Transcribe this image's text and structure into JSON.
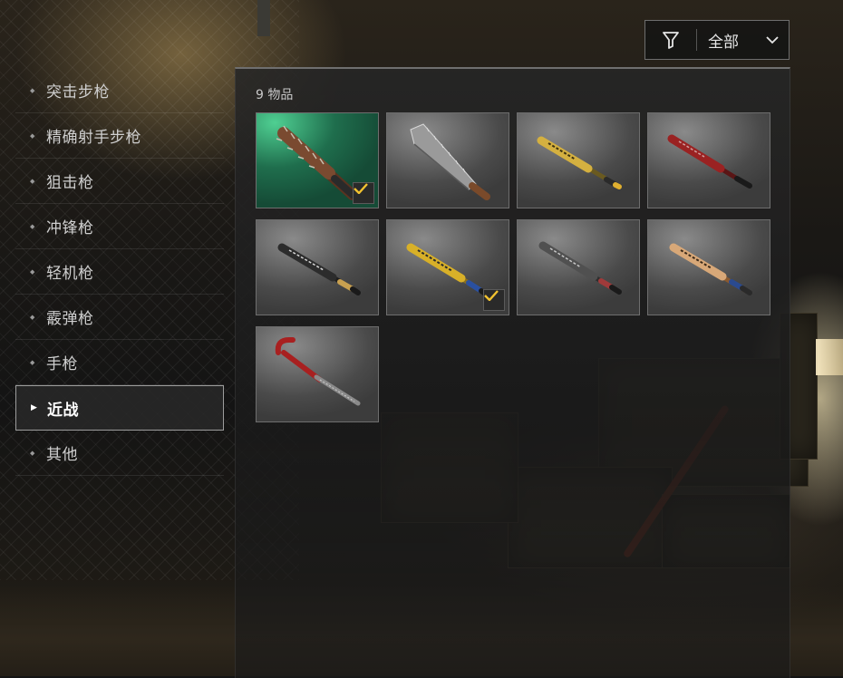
{
  "filter": {
    "value": "全部",
    "icon": "filter-icon",
    "chevron_icon": "chevron-down-icon"
  },
  "categories": [
    {
      "label": "突击步枪",
      "active": false
    },
    {
      "label": "精确射手步枪",
      "active": false
    },
    {
      "label": "狙击枪",
      "active": false
    },
    {
      "label": "冲锋枪",
      "active": false
    },
    {
      "label": "轻机枪",
      "active": false
    },
    {
      "label": "霰弹枪",
      "active": false
    },
    {
      "label": "手枪",
      "active": false
    },
    {
      "label": "近战",
      "active": true
    },
    {
      "label": "其他",
      "active": false
    }
  ],
  "items_count": "9 物品",
  "items": [
    {
      "name": "spiked-bat-item",
      "equipped": true,
      "rarity": "green"
    },
    {
      "name": "machete-item",
      "equipped": false,
      "rarity": "gray"
    },
    {
      "name": "gold-bat-item",
      "equipped": false,
      "rarity": "gray"
    },
    {
      "name": "red-bat-item",
      "equipped": false,
      "rarity": "gray"
    },
    {
      "name": "black-bat-item",
      "equipped": false,
      "rarity": "gray"
    },
    {
      "name": "yellow-blue-bat-item",
      "equipped": true,
      "rarity": "gray"
    },
    {
      "name": "gray-bat-item",
      "equipped": false,
      "rarity": "gray"
    },
    {
      "name": "wooden-bat-item",
      "equipped": false,
      "rarity": "gray"
    },
    {
      "name": "crowbar-item",
      "equipped": false,
      "rarity": "gray"
    }
  ],
  "colors": {
    "accent_check": "#f2c230",
    "rare_tile": "#1f6e4d"
  }
}
